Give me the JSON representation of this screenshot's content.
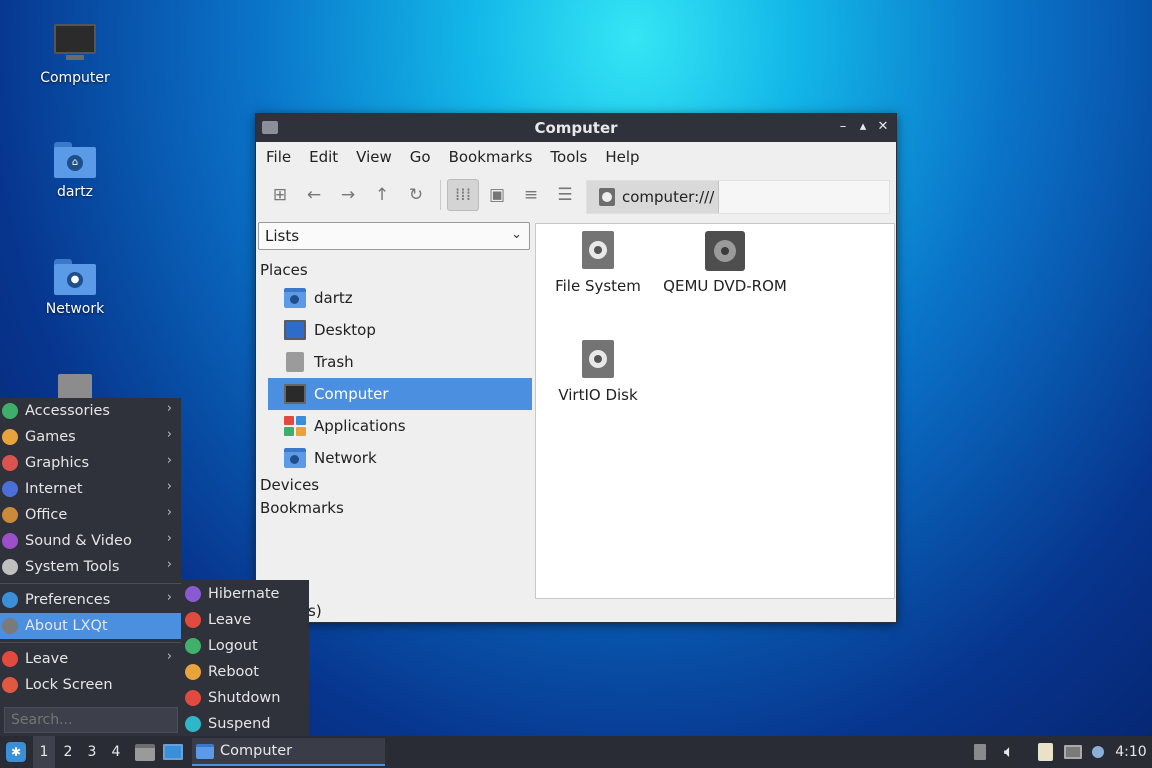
{
  "desktop": {
    "icons": [
      {
        "label": "Computer",
        "icon": "monitor-icon"
      },
      {
        "label": "dartz",
        "icon": "home-folder-icon"
      },
      {
        "label": "Network",
        "icon": "network-folder-icon"
      },
      {
        "label": "",
        "icon": "trash-icon"
      }
    ]
  },
  "window": {
    "title": "Computer",
    "buttons": {
      "minimize": "–",
      "maximize": "▴",
      "close": "✕"
    },
    "menubar": [
      "File",
      "Edit",
      "View",
      "Go",
      "Bookmarks",
      "Tools",
      "Help"
    ],
    "toolbar": {
      "icons": [
        "new-tab-icon",
        "back-icon",
        "forward-icon",
        "up-icon",
        "reload-icon",
        "icon-view-icon",
        "thumbnail-view-icon",
        "compact-view-icon",
        "detailed-list-icon"
      ],
      "path": "computer:///"
    },
    "sidepane": {
      "mode": "Lists",
      "places_heading": "Places",
      "places": [
        {
          "label": "dartz",
          "icon": "home-folder-icon"
        },
        {
          "label": "Desktop",
          "icon": "desktop-icon"
        },
        {
          "label": "Trash",
          "icon": "trash-icon"
        },
        {
          "label": "Computer",
          "icon": "monitor-icon",
          "selected": true
        },
        {
          "label": "Applications",
          "icon": "applications-icon"
        },
        {
          "label": "Network",
          "icon": "network-folder-icon"
        }
      ],
      "devices_heading": "Devices",
      "bookmarks_heading": "Bookmarks"
    },
    "files": [
      {
        "label": "File System",
        "icon": "harddisk-icon"
      },
      {
        "label": "QEMU DVD-ROM",
        "icon": "optical-drive-icon"
      },
      {
        "label": "VirtIO Disk",
        "icon": "harddisk-icon"
      }
    ],
    "status_fragment": "s)"
  },
  "startmenu": {
    "items": [
      {
        "label": "Accessories",
        "color": "#3fae6a",
        "submenu": true
      },
      {
        "label": "Games",
        "color": "#e8a33a",
        "submenu": true
      },
      {
        "label": "Graphics",
        "color": "#d9534f",
        "submenu": true
      },
      {
        "label": "Internet",
        "color": "#4a6fd8",
        "submenu": true
      },
      {
        "label": "Office",
        "color": "#c98a3a",
        "submenu": true
      },
      {
        "label": "Sound & Video",
        "color": "#9b4fc9",
        "submenu": true
      },
      {
        "label": "System Tools",
        "color": "#bfbfbf",
        "submenu": true
      }
    ],
    "items2": [
      {
        "label": "Preferences",
        "color": "#3a8fd8",
        "submenu": true
      },
      {
        "label": "About LXQt",
        "color": "#7a7a7a",
        "submenu": false,
        "selected": true
      }
    ],
    "items3": [
      {
        "label": "Leave",
        "color": "#e04a3f",
        "submenu": true
      },
      {
        "label": "Lock Screen",
        "color": "#e0583f",
        "submenu": false
      }
    ],
    "search_placeholder": "Search..."
  },
  "leavemenu": {
    "items": [
      {
        "label": "Hibernate",
        "color": "#8a5ad0"
      },
      {
        "label": "Leave",
        "color": "#e04a3f"
      },
      {
        "label": "Logout",
        "color": "#3fb16a"
      },
      {
        "label": "Reboot",
        "color": "#e8a33a"
      },
      {
        "label": "Shutdown",
        "color": "#e04a3f"
      },
      {
        "label": "Suspend",
        "color": "#2fb6c9"
      }
    ]
  },
  "taskbar": {
    "desktops": [
      "1",
      "2",
      "3",
      "4"
    ],
    "active_desktop": "1",
    "task_label": "Computer",
    "clock": "4:10",
    "tray_icons": [
      "eject-icon",
      "volume-icon",
      "clipboard-icon",
      "network-icon",
      "update-notifier-icon"
    ]
  },
  "colors": {
    "accent": "#4a8fe0",
    "panel": "#2f313b",
    "window_bg": "#efefef"
  }
}
